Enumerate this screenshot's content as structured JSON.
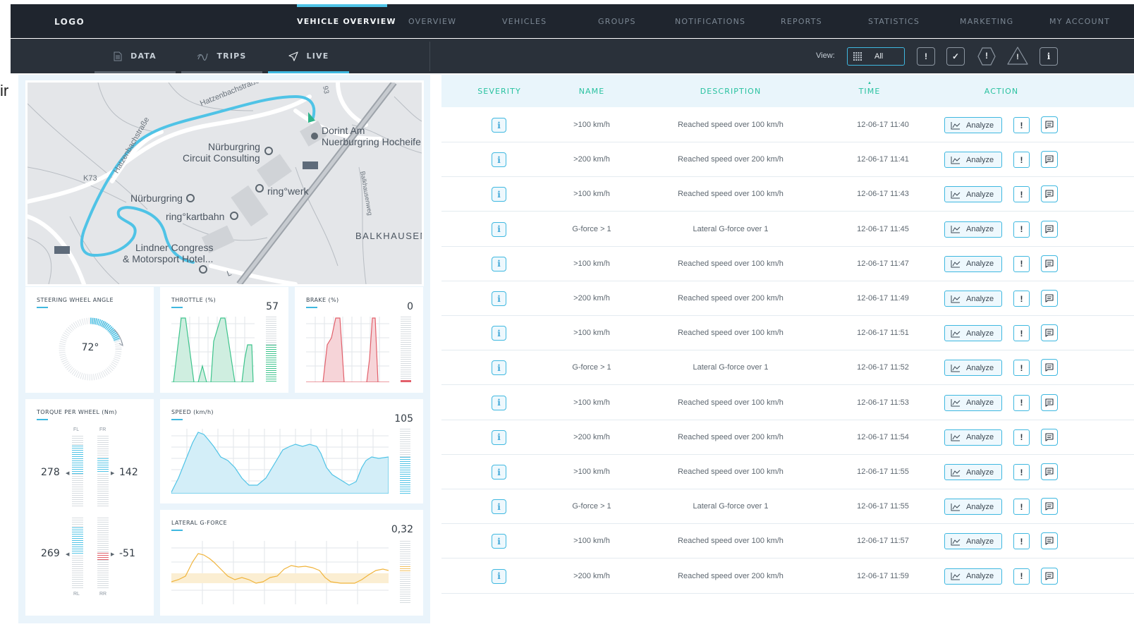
{
  "stray_text": "ir",
  "nav": {
    "logo": "LOGO",
    "items": [
      "VEHICLE OVERVIEW",
      "OVERVIEW",
      "VEHICLES",
      "GROUPS",
      "NOTIFICATIONS",
      "REPORTS",
      "STATISTICS",
      "MARKETING",
      "MY ACCOUNT"
    ],
    "active": "VEHICLE OVERVIEW"
  },
  "subnav": {
    "tabs": [
      {
        "label": "DATA",
        "icon": "document-icon"
      },
      {
        "label": "TRIPS",
        "icon": "trips-icon"
      },
      {
        "label": "LIVE",
        "icon": "navigation-arrow-icon"
      }
    ],
    "active": "LIVE",
    "view_label": "View:",
    "view_value": "All",
    "filters": [
      "!",
      "✓",
      "!",
      "!",
      "i"
    ]
  },
  "map": {
    "labels": {
      "hatzenbach": "Hatzenbachstraße",
      "hatzenbach2": "Hatzenbachstraße",
      "dorint1": "Dorint Am",
      "dorint2": "Nuerburgring Hocheife",
      "circuit1": "Nürburgring",
      "circuit2": "Circuit Consulting",
      "k73": "K73",
      "nurburgring": "Nürburgring",
      "ringwerk": "ring°werk",
      "kartbahn": "ring°kartbahn",
      "balkhausen": "BALKHAUSEN",
      "balkhausenweg": "Balkhausenweg",
      "lindner1": "Lindner Congress",
      "lindner2": "& Motorsport Hotel...",
      "road93": "93",
      "l": "L"
    }
  },
  "widgets": {
    "steering": {
      "title": "STEERING WHEEL ANGLE",
      "value": "72°"
    },
    "throttle": {
      "title": "THROTTLE (%)",
      "value": "57"
    },
    "brake": {
      "title": "BRAKE (%)",
      "value": "0"
    },
    "torque": {
      "title": "TORQUE PER WHEEL (Nm)",
      "fl_label": "FL",
      "fr_label": "FR",
      "rl_label": "RL",
      "rr_label": "RR",
      "fl": "278",
      "fr": "142",
      "rl": "269",
      "rr": "-51"
    },
    "speed": {
      "title": "SPEED (km/h)",
      "value": "105"
    },
    "lateral": {
      "title": "LATERAL G-FORCE",
      "value": "0,32"
    }
  },
  "table": {
    "headers": [
      "SEVERITY",
      "NAME",
      "DESCRIPTION",
      "TIME",
      "ACTION"
    ],
    "analyze_label": "Analyze",
    "rows": [
      {
        "severity": "i",
        "name": ">100 km/h",
        "description": "Reached speed over 100 km/h",
        "time": "12-06-17  11:40"
      },
      {
        "severity": "i",
        "name": ">200 km/h",
        "description": "Reached speed over 200 km/h",
        "time": "12-06-17  11:41"
      },
      {
        "severity": "i",
        "name": ">100 km/h",
        "description": "Reached speed over 100 km/h",
        "time": "12-06-17  11:43"
      },
      {
        "severity": "i",
        "name": "G-force > 1",
        "description": "Lateral G-force over 1",
        "time": "12-06-17  11:45"
      },
      {
        "severity": "i",
        "name": ">100 km/h",
        "description": "Reached speed over 100 km/h",
        "time": "12-06-17  11:47"
      },
      {
        "severity": "i",
        "name": ">200 km/h",
        "description": "Reached speed over 200 km/h",
        "time": "12-06-17  11:49"
      },
      {
        "severity": "i",
        "name": ">100 km/h",
        "description": "Reached speed over 100 km/h",
        "time": "12-06-17  11:51"
      },
      {
        "severity": "i",
        "name": "G-force > 1",
        "description": "Lateral G-force over 1",
        "time": "12-06-17  11:52"
      },
      {
        "severity": "i",
        "name": ">100 km/h",
        "description": "Reached speed over 100 km/h",
        "time": "12-06-17  11:53"
      },
      {
        "severity": "i",
        "name": ">200 km/h",
        "description": "Reached speed over 200 km/h",
        "time": "12-06-17  11:54"
      },
      {
        "severity": "i",
        "name": ">100 km/h",
        "description": "Reached speed over 100 km/h",
        "time": "12-06-17  11:55"
      },
      {
        "severity": "i",
        "name": "G-force > 1",
        "description": "Lateral G-force over 1",
        "time": "12-06-17  11:55"
      },
      {
        "severity": "i",
        "name": ">100 km/h",
        "description": "Reached speed over 100 km/h",
        "time": "12-06-17  11:57"
      },
      {
        "severity": "i",
        "name": ">200 km/h",
        "description": "Reached speed over 200 km/h",
        "time": "12-06-17  11:59"
      }
    ]
  },
  "colors": {
    "accent": "#3fb8e0",
    "header_text": "#29c2a0",
    "throttle": "#3ec48c",
    "brake": "#e2606b",
    "speed": "#4fc3e6",
    "lateral": "#f0c060",
    "nav_bg": "#1f252e"
  }
}
